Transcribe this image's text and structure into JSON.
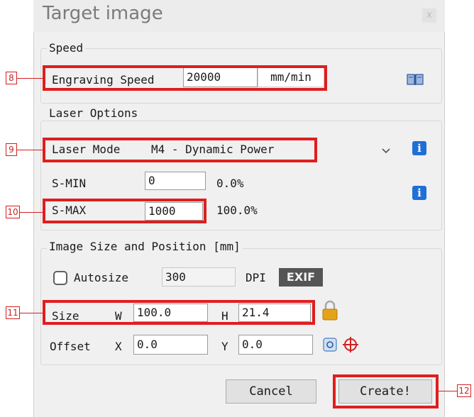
{
  "window": {
    "title": "Target image",
    "close_glyph": "x"
  },
  "speed": {
    "legend": "Speed",
    "engraving_label": "Engraving Speed",
    "engraving_value": "20000",
    "unit": "mm/min",
    "book_icon": "book-icon"
  },
  "laser": {
    "legend": "Laser Options",
    "mode_label": "Laser Mode",
    "mode_value": "M4 - Dynamic Power",
    "smin_label": "S-MIN",
    "smin_value": "0",
    "smin_percent": "0.0%",
    "smax_label": "S-MAX",
    "smax_value": "1000",
    "smax_percent": "100.0%",
    "info_glyph": "i"
  },
  "image": {
    "legend": "Image Size and Position [mm]",
    "autosize_label": "Autosize",
    "autosize_checked": false,
    "dpi_value": "300",
    "dpi_label": "DPI",
    "exif_label": "EXIF",
    "size_label": "Size",
    "w_label": "W",
    "w_value": "100.0",
    "h_label": "H",
    "h_value": "21.4",
    "offset_label": "Offset",
    "x_label": "X",
    "x_value": "0.0",
    "y_label": "Y",
    "y_value": "0.0"
  },
  "buttons": {
    "cancel": "Cancel",
    "create": "Create!"
  },
  "callouts": {
    "c8": "8",
    "c9": "9",
    "c10": "10",
    "c11": "11",
    "c12": "12"
  },
  "colors": {
    "highlight": "#e01e1e",
    "info": "#1f6fd6",
    "lock": "#e3a21a",
    "target": "#d42020"
  }
}
